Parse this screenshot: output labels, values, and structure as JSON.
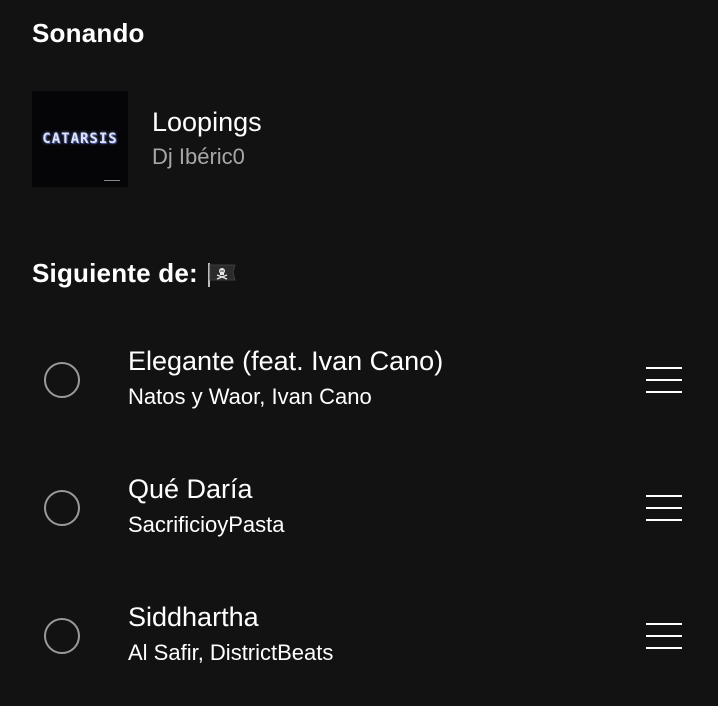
{
  "now_playing": {
    "section_label": "Sonando",
    "track": "Loopings",
    "artist": "Dj Ibéric0",
    "cover_text": "CATARSIS"
  },
  "queue": {
    "section_label": "Siguiente de:",
    "source_icon": "pirate-flag-icon",
    "items": [
      {
        "track": "Elegante (feat. Ivan Cano)",
        "artist": "Natos y Waor, Ivan Cano"
      },
      {
        "track": "Qué Daría",
        "artist": "SacrificioyPasta"
      },
      {
        "track": "Siddhartha",
        "artist": "Al Safir, DistrictBeats"
      }
    ]
  },
  "colors": {
    "background": "#121212",
    "primary_text": "#ffffff",
    "secondary_text": "#a7a7a7",
    "radio_border": "#9a9a9a"
  }
}
